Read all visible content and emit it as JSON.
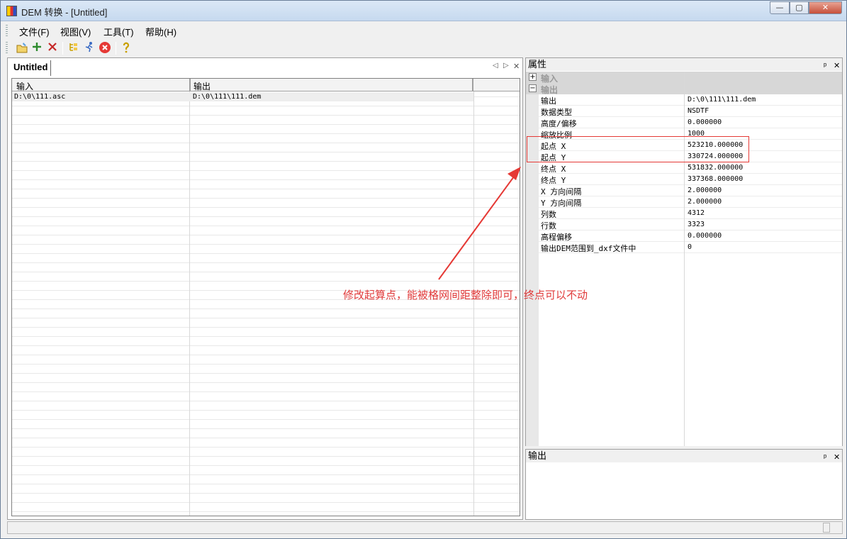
{
  "window": {
    "title": "DEM 转换 - [Untitled]",
    "min": "—",
    "max": "▢",
    "close": "✕"
  },
  "menu": [
    "文件(F)",
    "视图(V)",
    "工具(T)",
    "帮助(H)"
  ],
  "toolbar": {
    "icons": [
      "open-icon",
      "add-icon",
      "delete-icon",
      "list-icon",
      "run-icon",
      "stop-icon",
      "help-icon"
    ],
    "colors": {
      "add": "#2e8b2e",
      "delete": "#c62828",
      "stop": "#e53935",
      "help": "#c9a000"
    }
  },
  "document": {
    "tab": "Untitled",
    "nav": {
      "prev": "◁",
      "next": "▷",
      "close": "✕"
    },
    "columns": [
      "输入",
      "输出"
    ],
    "rows": [
      {
        "input": "D:\\0\\111.asc",
        "output": "D:\\0\\111\\111.dem"
      }
    ]
  },
  "properties": {
    "title": "属性",
    "pin": "ᵖ",
    "close": "✕",
    "categories": [
      {
        "label": "输入",
        "toggle": "+"
      },
      {
        "label": "输出",
        "toggle": "−"
      }
    ],
    "rows": [
      {
        "name": "输出",
        "value": "D:\\0\\111\\111.dem"
      },
      {
        "name": "数据类型",
        "value": "NSDTF"
      },
      {
        "name": "高度/偏移",
        "value": "0.000000"
      },
      {
        "name": "缩放比例",
        "value": "1000"
      },
      {
        "name": "起点 X",
        "value": "523210.000000"
      },
      {
        "name": "起点 Y",
        "value": "330724.000000"
      },
      {
        "name": "终点 X",
        "value": "531832.000000"
      },
      {
        "name": "终点 Y",
        "value": "337368.000000"
      },
      {
        "name": "X 方向间隔",
        "value": "2.000000"
      },
      {
        "name": "Y 方向间隔",
        "value": "2.000000"
      },
      {
        "name": "列数",
        "value": "4312"
      },
      {
        "name": "行数",
        "value": "3323"
      },
      {
        "name": "高程偏移",
        "value": "0.000000"
      },
      {
        "name": "输出DEM范围到_dxf文件中",
        "value": "0"
      }
    ]
  },
  "output_panel": {
    "title": "输出",
    "pin": "ᵖ",
    "close": "✕"
  },
  "annotation": {
    "text": "修改起算点，能被格网间距整除即可，终点可以不动",
    "color": "#e53935"
  }
}
